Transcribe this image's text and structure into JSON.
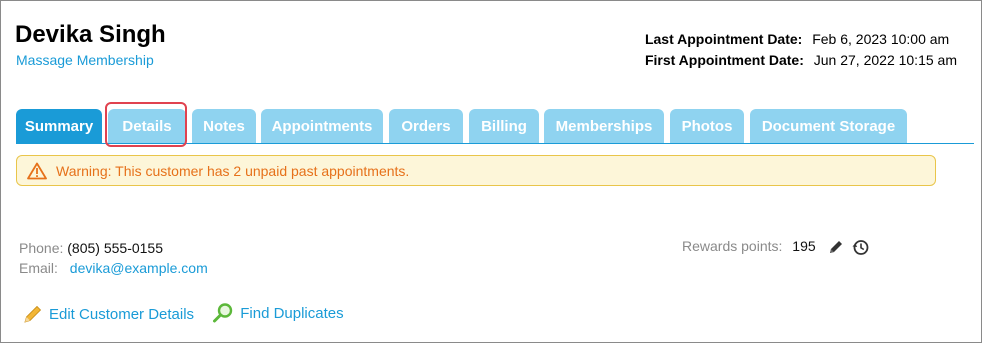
{
  "customer": {
    "name": "Devika Singh",
    "membership": "Massage Membership"
  },
  "appointment_dates": {
    "last_label": "Last Appointment Date:",
    "last_value": "Feb 6, 2023 10:00 am",
    "first_label": "First Appointment Date:",
    "first_value": "Jun 27, 2022 10:15 am"
  },
  "tabs": [
    {
      "label": "Summary",
      "active": true
    },
    {
      "label": "Details",
      "active": false,
      "highlighted": true
    },
    {
      "label": "Notes",
      "active": false
    },
    {
      "label": "Appointments",
      "active": false
    },
    {
      "label": "Orders",
      "active": false
    },
    {
      "label": "Billing",
      "active": false
    },
    {
      "label": "Memberships",
      "active": false
    },
    {
      "label": "Photos",
      "active": false
    },
    {
      "label": "Document Storage",
      "active": false
    }
  ],
  "warning": {
    "icon": "warning-triangle-icon",
    "text": "Warning: This customer has 2 unpaid past appointments."
  },
  "contact": {
    "phone_label": "Phone:",
    "phone_value": "(805) 555-0155",
    "email_label": "Email:",
    "email_value": "devika@example.com"
  },
  "rewards": {
    "label": "Rewards points:",
    "value": "195",
    "edit_icon": "pencil-icon",
    "history_icon": "history-clock-icon"
  },
  "actions": {
    "edit_label": "Edit Customer Details",
    "find_label": "Find Duplicates"
  },
  "colors": {
    "accent": "#1a9bd7",
    "tab_inactive": "#8fd3f0",
    "warning_bg": "#fdf6d9",
    "warning_border": "#e9c54a",
    "warning_text": "#e6711a",
    "highlight": "#e0424f"
  }
}
